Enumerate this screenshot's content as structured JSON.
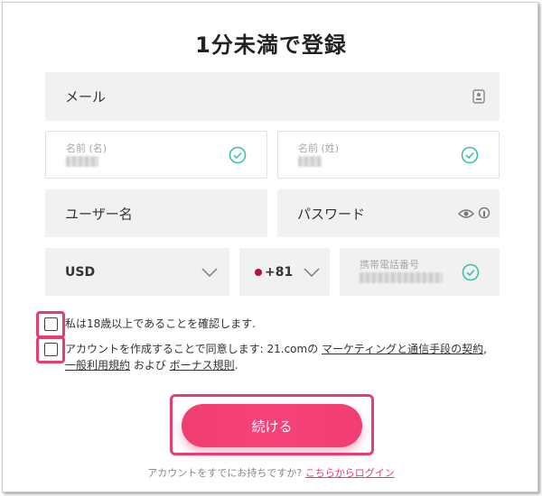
{
  "page": {
    "title": "1分未満で登録"
  },
  "form": {
    "email_label": "メール",
    "first_name_label": "名前 (名)",
    "last_name_label": "名前 (姓)",
    "username_label": "ユーザー名",
    "password_label": "パスワード",
    "currency_value": "USD",
    "country_code_value": "+81",
    "phone_label": "携帯電話番号"
  },
  "consent": {
    "age_text": "私は18歳以上であることを確認します.",
    "terms_prefix": "アカウントを作成することで同意します: 21.comの ",
    "terms_link_marketing": "マーケティングと通信手段の契約",
    "terms_sep": ", ",
    "terms_link_general": "一般利用規約",
    "terms_and": " および ",
    "terms_link_bonus": "ボーナス規則",
    "terms_end": "."
  },
  "actions": {
    "continue_label": "続ける"
  },
  "footer": {
    "question": "アカウントをすでにお持ちですか? ",
    "login_link": "こちらからログイン"
  },
  "colors": {
    "accent": "#e83e6e",
    "button_gradient": "#f03d72",
    "check_teal": "#3cbfae",
    "field_bg": "#f1f1f1"
  },
  "icons": [
    "contact-card-icon",
    "check-circle-icon",
    "eye-icon",
    "key-icon",
    "chevron-down-icon",
    "japan-flag-icon"
  ]
}
